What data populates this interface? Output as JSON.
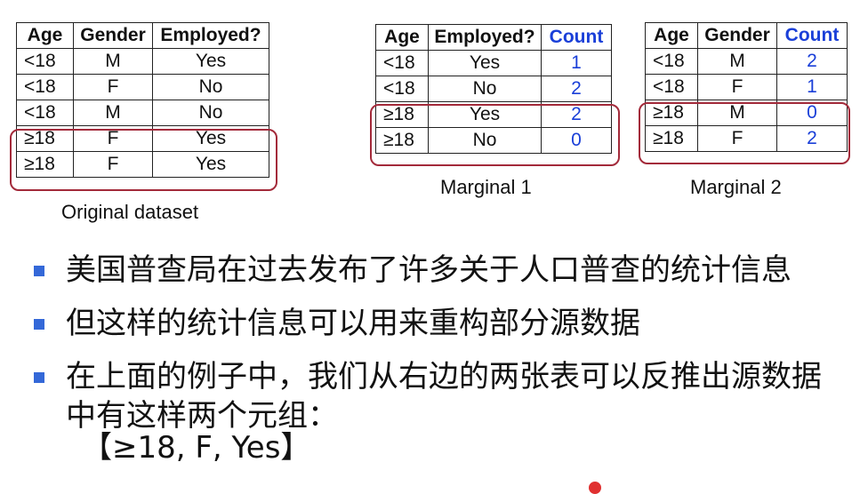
{
  "tables": {
    "original": {
      "headers": [
        "Age",
        "Gender",
        "Employed?"
      ],
      "rows": [
        [
          "<18",
          "M",
          "Yes"
        ],
        [
          "<18",
          "F",
          "No"
        ],
        [
          "<18",
          "M",
          "No"
        ],
        [
          "≥18",
          "F",
          "Yes"
        ],
        [
          "≥18",
          "F",
          "Yes"
        ]
      ],
      "caption": "Original dataset"
    },
    "marginal1": {
      "headers": [
        "Age",
        "Employed?",
        "Count"
      ],
      "rows": [
        [
          "<18",
          "Yes",
          "1"
        ],
        [
          "<18",
          "No",
          "2"
        ],
        [
          "≥18",
          "Yes",
          "2"
        ],
        [
          "≥18",
          "No",
          "0"
        ]
      ],
      "caption": "Marginal 1"
    },
    "marginal2": {
      "headers": [
        "Age",
        "Gender",
        "Count"
      ],
      "rows": [
        [
          "<18",
          "M",
          "2"
        ],
        [
          "<18",
          "F",
          "1"
        ],
        [
          "≥18",
          "M",
          "0"
        ],
        [
          "≥18",
          "F",
          "2"
        ]
      ],
      "caption": "Marginal 2"
    }
  },
  "bullets": [
    "美国普查局在过去发布了许多关于人口普查的统计信息",
    "但这样的统计信息可以用来重构部分源数据",
    "在上面的例子中，我们从右边的两张表可以反推出源数据中有这样两个元组："
  ],
  "tuple": "【≥18, F, Yes】",
  "colors": {
    "highlight_border": "#a32a3a",
    "count_text": "#1a3fd8",
    "bullet_square": "#3468d8"
  }
}
